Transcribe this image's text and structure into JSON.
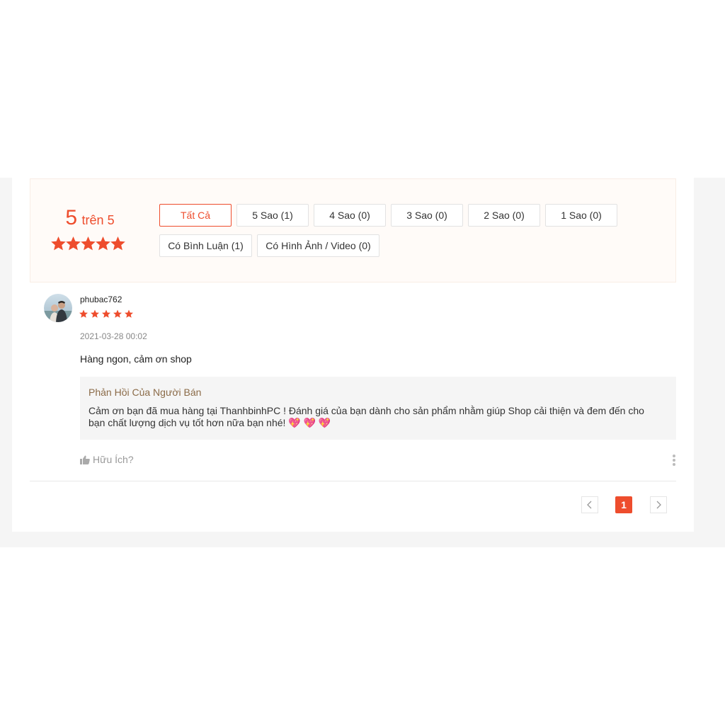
{
  "rating_overview": {
    "score": "5",
    "out_of": "trên 5",
    "star_count": 5,
    "accent_color": "#ee4d2d",
    "filters": [
      {
        "label": "Tất Cả",
        "active": true
      },
      {
        "label": "5 Sao (1)",
        "active": false
      },
      {
        "label": "4 Sao (0)",
        "active": false
      },
      {
        "label": "3 Sao (0)",
        "active": false
      },
      {
        "label": "2 Sao (0)",
        "active": false
      },
      {
        "label": "1 Sao (0)",
        "active": false
      },
      {
        "label": "Có Bình Luận (1)",
        "active": false
      },
      {
        "label": "Có Hình Ảnh / Video (0)",
        "active": false
      }
    ]
  },
  "review": {
    "username": "phubac762",
    "rating": 5,
    "date": "2021-03-28 00:02",
    "text": "Hàng ngon, cảm ơn shop",
    "seller_reply": {
      "title": "Phản Hồi Của Người Bán",
      "body": "Cảm ơn bạn đã mua hàng tại ThanhbinhPC ! Đánh giá của bạn dành cho sản phẩm nhằm giúp Shop cải thiện và đem đến cho bạn chất lượng dịch vụ tốt hơn nữa bạn nhé! 💖 💖 💖"
    },
    "helpful_label": "Hữu Ích?"
  },
  "pagination": {
    "prev_icon": "chevron-left-icon",
    "current_page": "1",
    "next_icon": "chevron-right-icon"
  }
}
